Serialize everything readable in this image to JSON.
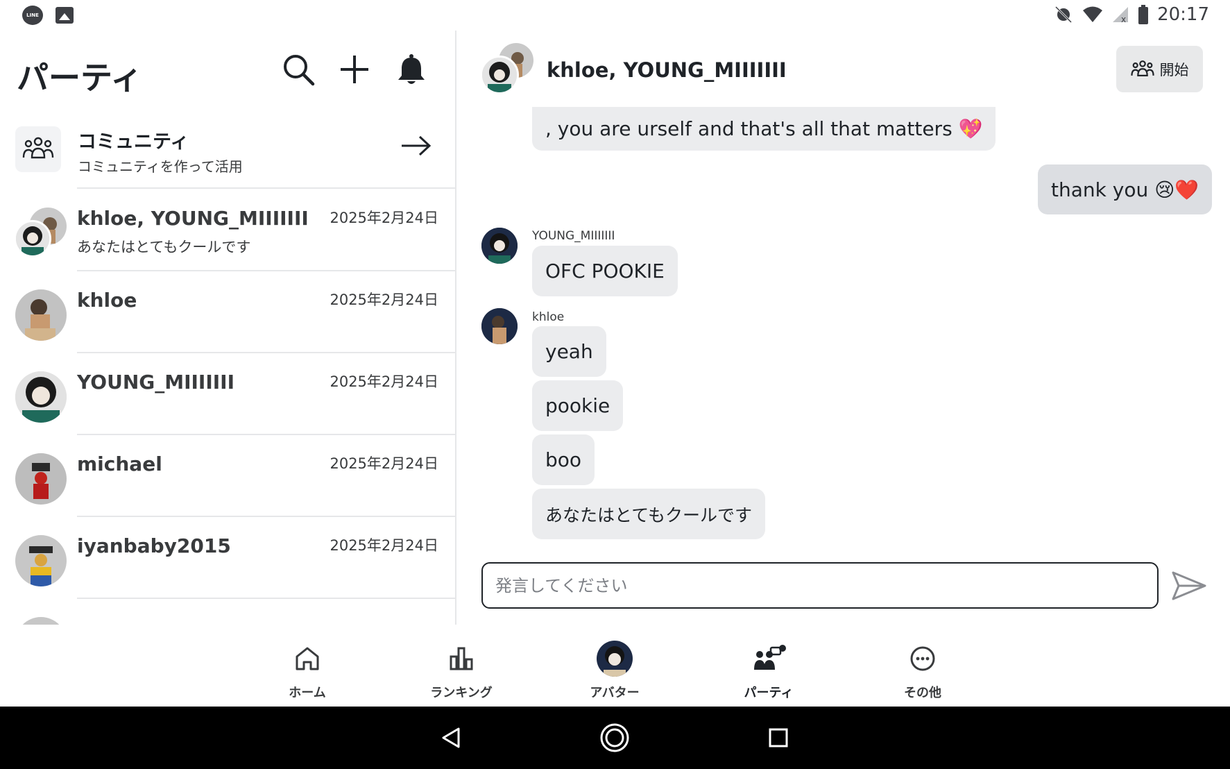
{
  "status_bar": {
    "left_icons": [
      "line-icon",
      "gallery-icon"
    ],
    "right_icons": [
      "alarm-off-icon",
      "wifi-icon",
      "signal-off-icon",
      "battery-icon"
    ],
    "line_label": "LINE",
    "time": "20:17"
  },
  "left_panel": {
    "title": "パーティ",
    "header_icons": [
      "search-icon",
      "plus-icon",
      "bell-icon"
    ],
    "community": {
      "title": "コミュニティ",
      "subtitle": "コミュニティを作って活用"
    },
    "conversations": [
      {
        "name": "khloe, YOUNG_MIIIIIII",
        "date": "2025年2月24日",
        "preview": "あなたはとてもクールです"
      },
      {
        "name": "khloe",
        "date": "2025年2月24日",
        "preview": ""
      },
      {
        "name": "YOUNG_MIIIIIII",
        "date": "2025年2月24日",
        "preview": ""
      },
      {
        "name": "michael",
        "date": "2025年2月24日",
        "preview": ""
      },
      {
        "name": "iyanbaby2015",
        "date": "2025年2月24日",
        "preview": ""
      }
    ]
  },
  "chat": {
    "title": "khloe, YOUNG_MIIIIIII",
    "start_button": "開始",
    "messages": {
      "m1": ", you are urself and that's all that matters 💖",
      "m2": "thank you 😢❤️",
      "sender_young": "YOUNG_MIIIIIII",
      "m3": "OFC POOKIE",
      "sender_khloe": "khloe",
      "m4": "yeah",
      "m5": "pookie",
      "m6": "boo",
      "m7": "あなたはとてもクールです"
    },
    "composer": {
      "placeholder": "発言してください",
      "value": ""
    }
  },
  "bottom_nav": {
    "items": [
      {
        "label": "ホーム",
        "icon": "home-icon"
      },
      {
        "label": "ランキング",
        "icon": "chart-icon"
      },
      {
        "label": "アバター",
        "icon": "avatar-icon"
      },
      {
        "label": "パーティ",
        "icon": "party-icon",
        "active": true
      },
      {
        "label": "その他",
        "icon": "more-icon"
      }
    ]
  },
  "colors": {
    "text": "#1f2328",
    "secondary_text": "#393b3d",
    "bubble": "#ebecee",
    "divider": "#e6e7e9",
    "system_nav": "#000000"
  }
}
